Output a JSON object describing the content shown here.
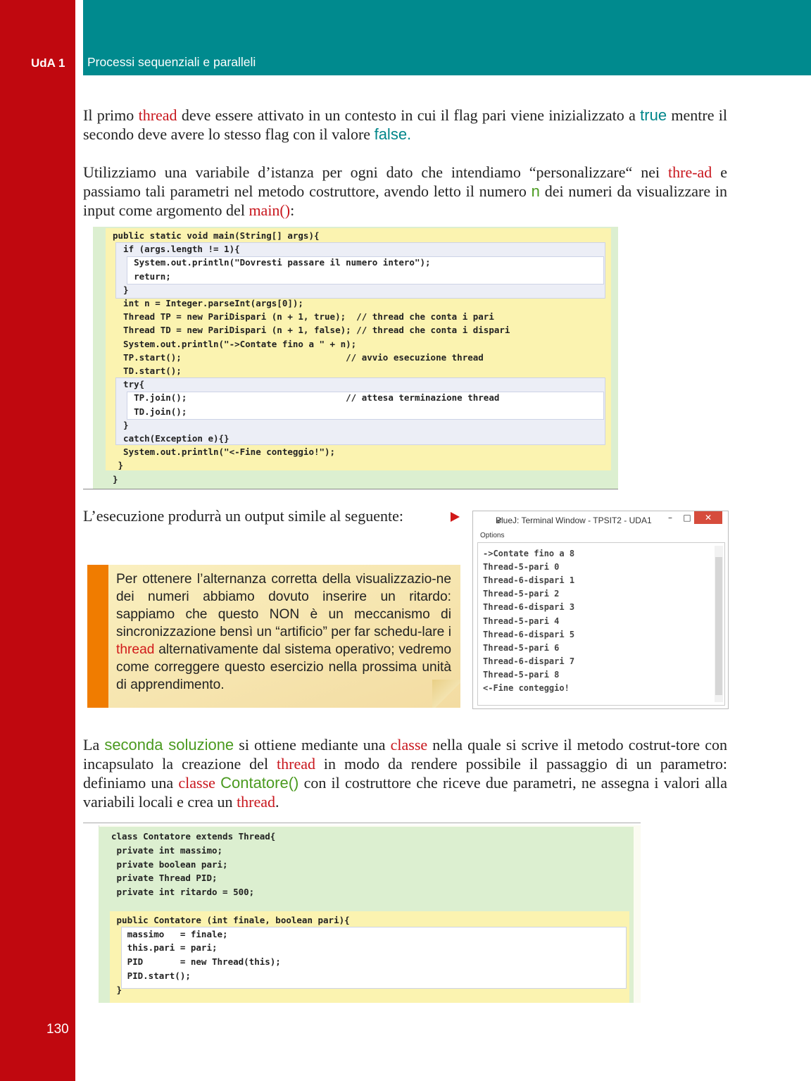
{
  "header": {
    "unit_label": "UdA 1",
    "title": "Processi sequenziali e paralleli"
  },
  "page_number": "130",
  "paragraph1": {
    "t1": "Il primo ",
    "r1": "thread",
    "t2": " deve essere attivato in un contesto in cui il flag pari viene inizializzato a ",
    "k1": "true",
    "t3": " mentre il secondo deve avere lo stesso flag con il valore ",
    "k2": "false."
  },
  "paragraph2": {
    "t1": "Utilizziamo una variabile d’istanza per ogni dato che intendiamo “personalizzare“ nei ",
    "r1": "thre-ad",
    "t2": " e passiamo tali parametri nel metodo costruttore, avendo letto il numero ",
    "g1": "n",
    "t3": " dei numeri da visualizzare in input come argomento del ",
    "r2": "main()",
    "t4": ":"
  },
  "code1": {
    "lines": [
      "public static void main(String[] args){",
      "  if (args.length != 1){",
      "    System.out.println(\"Dovresti passare il numero intero\");",
      "    return;",
      "  }",
      "  int n = Integer.parseInt(args[0]);",
      "  Thread TP = new PariDispari (n + 1, true);  // thread che conta i pari",
      "  Thread TD = new PariDispari (n + 1, false); // thread che conta i dispari",
      "  System.out.println(\"->Contate fino a \" + n);",
      "  TP.start();                               // avvio esecuzione thread",
      "  TD.start();",
      "  try{",
      "    TP.join();                              // attesa terminazione thread",
      "    TD.join();",
      "  }",
      "  catch(Exception e){}",
      "  System.out.println(\"<-Fine conteggio!\");",
      " }",
      "}"
    ]
  },
  "intro_output": "L’esecuzione produrrà un output simile al seguente:",
  "note": {
    "t1": "Per ottenere l’alternanza corretta della visualizzazio-ne dei numeri abbiamo dovuto inserire un ritardo: sappiamo che questo NON è un meccanismo di sincronizzazione bensì un “artificio” per far schedu-lare i ",
    "r1": "thread",
    "t2": " alternativamente dal sistema operativo; vedremo come correggere questo esercizio nella prossima unità di apprendimento."
  },
  "terminal": {
    "title": "BlueJ: Terminal Window - TPSIT2 - UDA1",
    "menu": "Options",
    "minimize": "–",
    "maximize": "□",
    "close": "✕",
    "lines": [
      "->Contate fino a 8",
      "Thread-5-pari 0",
      "Thread-6-dispari 1",
      "Thread-5-pari 2",
      "Thread-6-dispari 3",
      "Thread-5-pari 4",
      "Thread-6-dispari 5",
      "Thread-5-pari 6",
      "Thread-6-dispari 7",
      "Thread-5-pari 8",
      "<-Fine conteggio!"
    ]
  },
  "paragraph3": {
    "t1": "La ",
    "g1": "seconda soluzione",
    "t2": " si ottiene mediante una ",
    "r1": "classe",
    "t3": " nella quale si scrive il metodo costrut-tore con incapsulato la creazione del ",
    "r2": "thread",
    "t4": " in modo da rendere possibile il passaggio di un parametro: definiamo una ",
    "r3": "classe",
    "t5": " ",
    "g2": "Contatore()",
    "t6": " con il costruttore che riceve due parametri, ne assegna i valori alla variabili locali e crea un ",
    "r4": "thread",
    "t7": "."
  },
  "code2": {
    "lines": [
      "class Contatore extends Thread{",
      " private int massimo;",
      " private boolean pari;",
      " private Thread PID;",
      " private int ritardo = 500;",
      "",
      " public Contatore (int finale, boolean pari){",
      "   massimo   = finale;",
      "   this.pari = pari;",
      "   PID       = new Thread(this);",
      "   PID.start();",
      " }"
    ]
  },
  "colors": {
    "sidebar": "#c0080f",
    "header_band": "#008a8e",
    "accent_red": "#c8161d",
    "accent_teal": "#00868a",
    "accent_green": "#4a9a1f",
    "note_bar": "#f07c00"
  }
}
